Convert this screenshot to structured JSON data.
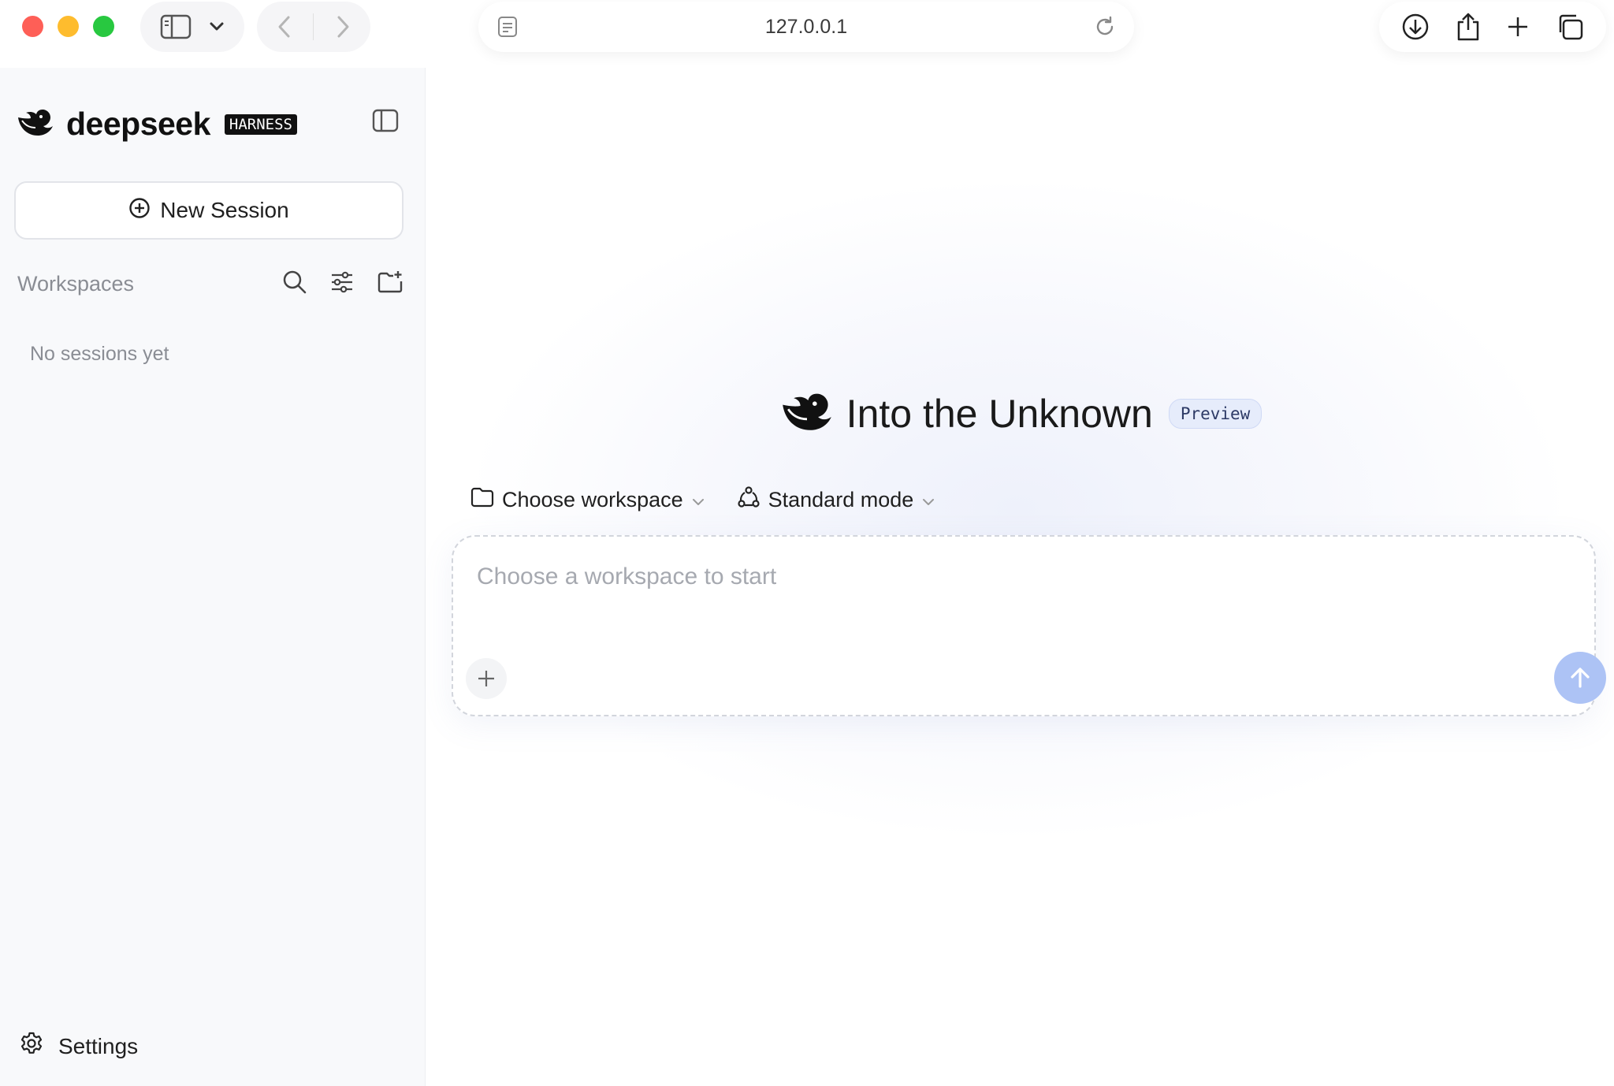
{
  "browser": {
    "url": "127.0.0.1",
    "traffic_colors": [
      "#fe5f57",
      "#febc2e",
      "#28c840"
    ],
    "icons": [
      "sidebar-icon",
      "chevron-down-icon",
      "back-icon",
      "forward-icon",
      "page-menu-icon",
      "reload-icon",
      "download-icon",
      "share-icon",
      "plus-icon",
      "tabs-icon"
    ]
  },
  "sidebar": {
    "brand_name": "deepseek",
    "brand_tag": "HARNESS",
    "new_session_label": "New Session",
    "workspaces_label": "Workspaces",
    "empty_text": "No sessions yet",
    "settings_label": "Settings"
  },
  "main": {
    "hero_title": "Into the Unknown",
    "preview_badge": "Preview",
    "workspace_selector": "Choose workspace",
    "mode_selector": "Standard mode",
    "composer_placeholder": "Choose a workspace to start"
  },
  "colors": {
    "accent_send": "#adc3f5",
    "badge_bg": "#e6ecfb"
  }
}
